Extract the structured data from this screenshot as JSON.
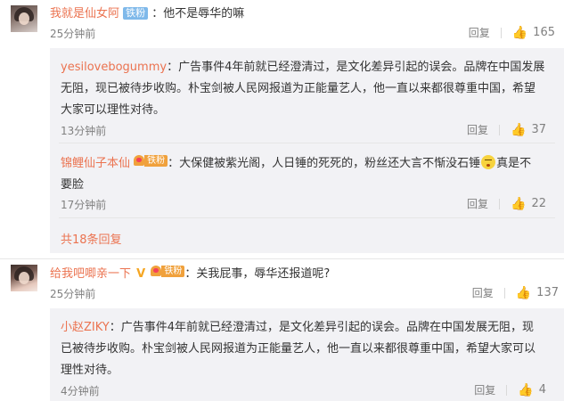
{
  "comments": [
    {
      "username": "我就是仙女阿",
      "badge": "铁粉",
      "text": "：他不是辱华的嘛",
      "time": "25分钟前",
      "reply_label": "回复",
      "likes": "165",
      "replies": [
        {
          "username": "yesilovebogummy",
          "text_line1": "：广告事件4年前就已经澄清过，是文化差异引起的误会。品牌在中国发展",
          "text_line2": "无阻，现已被待步收购。朴宝剑被人民网报道为正能量艺人，他一直以来都很尊重中国，希望",
          "text_line3": "大家可以理性对待。",
          "time": "13分钟前",
          "reply_label": "回复",
          "likes": "37"
        },
        {
          "username": "锦鲤仙子本仙",
          "badge": "铁粉",
          "text_line1a": "：大保健被紫光阁，人日锤的死死的，粉丝还大言不惭没石锤",
          "text_line1b": "真是不",
          "text_line2": "要脸",
          "time": "17分钟前",
          "reply_label": "回复",
          "likes": "22"
        }
      ],
      "more_replies": "共18条回复"
    },
    {
      "username": "给我吧唧亲一下",
      "badge": "铁粉",
      "text": "：关我屁事，辱华还报道呢?",
      "time": "25分钟前",
      "reply_label": "回复",
      "likes": "137",
      "replies": [
        {
          "username": "小赵ZIKY",
          "text_line1": "：广告事件4年前就已经澄清过，是文化差异引起的误会。品牌在中国发展无阻，现",
          "text_line2": "已被待步收购。朴宝剑被人民网报道为正能量艺人，他一直以来都很尊重中国，希望大家可以",
          "text_line3": "理性对待。",
          "time": "4分钟前",
          "reply_label": "回复",
          "likes": "4"
        }
      ]
    }
  ],
  "colors": {
    "username": "#eb7350",
    "meta": "#808080",
    "reply_bg": "#f2f2f5",
    "badge_blue": "#7fb9ea",
    "badge_fan": "#f0a13c"
  },
  "icons": [
    "thumbs-up-icon",
    "heart-badge-icon",
    "vip-v-icon",
    "emoji-face-icon"
  ]
}
